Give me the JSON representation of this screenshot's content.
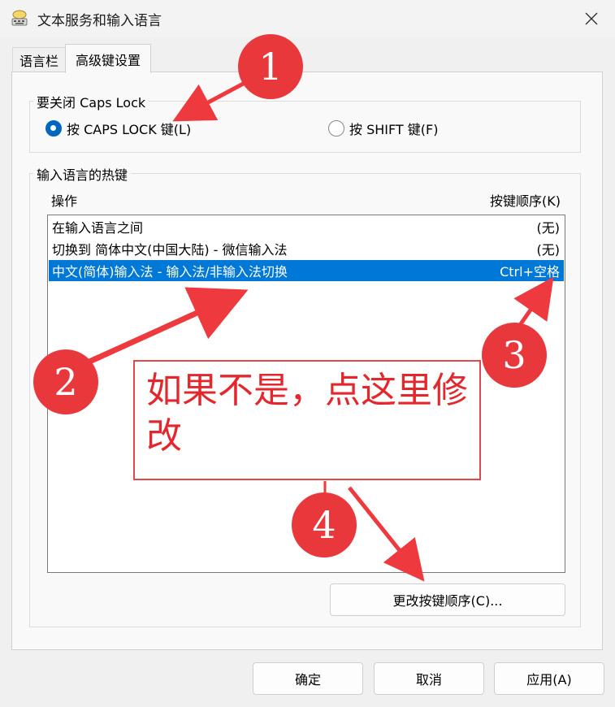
{
  "window": {
    "title": "文本服务和输入语言"
  },
  "tabs": [
    {
      "label": "语言栏"
    },
    {
      "label": "高级键设置"
    }
  ],
  "caps_lock_group": {
    "legend": "要关闭 Caps Lock",
    "options": [
      {
        "label": "按 CAPS LOCK 键(L)",
        "selected": true
      },
      {
        "label": "按 SHIFT 键(F)",
        "selected": false
      }
    ]
  },
  "hotkeys_group": {
    "legend": "输入语言的热键",
    "columns": {
      "action": "操作",
      "key_sequence": "按键顺序(K)"
    },
    "rows": [
      {
        "action": "在输入语言之间",
        "key": "(无)",
        "selected": false
      },
      {
        "action": "切换到 简体中文(中国大陆) - 微信输入法",
        "key": "(无)",
        "selected": false
      },
      {
        "action": "中文(简体)输入法 - 输入法/非输入法切换",
        "key": "Ctrl+空格",
        "selected": true
      }
    ],
    "change_button": "更改按键顺序(C)..."
  },
  "footer": {
    "ok": "确定",
    "cancel": "取消",
    "apply": "应用(A)"
  },
  "annotations": {
    "note_text": "如果不是，点这里修改",
    "badges": [
      "1",
      "2",
      "3",
      "4"
    ],
    "color": "#e8383c"
  },
  "colors": {
    "selection": "#0078d7",
    "radio_accent": "#0067c0"
  }
}
